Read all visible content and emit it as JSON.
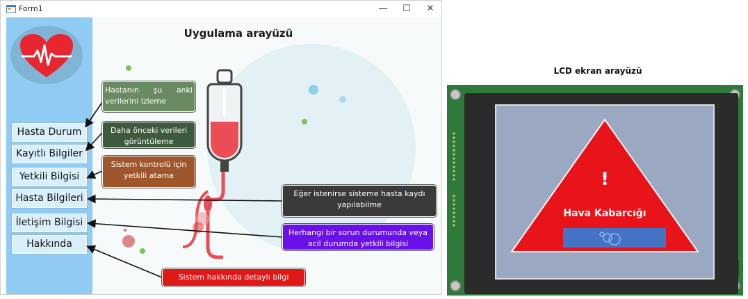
{
  "window": {
    "title": "Form1",
    "controls": {
      "minimize": "—",
      "maximize": "☐",
      "close": "✕"
    }
  },
  "app": {
    "heading": "Uygulama arayüzü",
    "logo_icon": "heart-ecg-icon"
  },
  "nav": [
    {
      "label": "Hasta Durum"
    },
    {
      "label": "Kayıtlı Bilgiler"
    },
    {
      "label": "Yetkili Bilgisi"
    },
    {
      "label": "Hasta Bilgileri"
    },
    {
      "label": "İletişim Bilgisi"
    },
    {
      "label": "Hakkında"
    }
  ],
  "callouts": [
    {
      "text": "Hastanın şu anki verilerini izleme",
      "color": "#6a8a62"
    },
    {
      "text": "Daha önceki verileri görüntüleme",
      "color": "#3d5a3c"
    },
    {
      "text": "Sistem kontrolü için yetkili atama",
      "color": "#a0562b"
    },
    {
      "text": "Eğer istenirse sisteme hasta kaydı yapılabilme",
      "color": "#3a3a3a"
    },
    {
      "text": "Herhangi bir sorun durumunda veya acil durumda yetkili bilgisi",
      "color": "#6a10e8"
    },
    {
      "text": "Sistem hakkında detaylı bilgi",
      "color": "#e01818"
    }
  ],
  "lcd": {
    "heading": "LCD ekran arayüzü",
    "alert_symbol": "!",
    "alert_text": "Hava Kabarcığı",
    "alert_color": "#e8141a",
    "bubble_bar_color": "#4472c4"
  }
}
